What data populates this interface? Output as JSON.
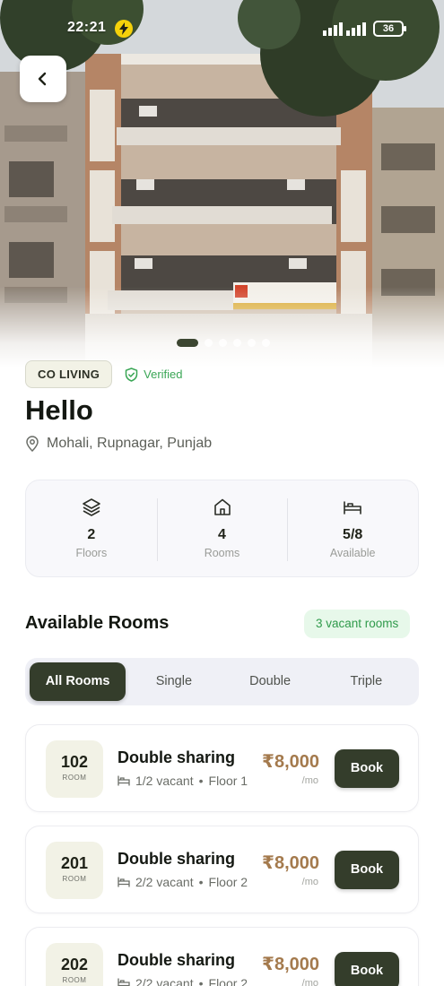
{
  "status_bar": {
    "time": "22:21",
    "battery": "36"
  },
  "gallery": {
    "image_count": 6,
    "active_index": 0
  },
  "property": {
    "category": "CO LIVING",
    "verified_label": "Verified",
    "name": "Hello",
    "location": "Mohali, Rupnagar, Punjab"
  },
  "stats": [
    {
      "icon": "layers-icon",
      "value": "2",
      "label": "Floors"
    },
    {
      "icon": "home-icon",
      "value": "4",
      "label": "Rooms"
    },
    {
      "icon": "bed-icon",
      "value": "5/8",
      "label": "Available"
    }
  ],
  "available_rooms": {
    "title": "Available Rooms",
    "vacant_badge": "3 vacant rooms",
    "tabs": [
      "All Rooms",
      "Single",
      "Double",
      "Triple"
    ],
    "active_tab": "All Rooms"
  },
  "rooms": [
    {
      "number": "102",
      "room_label": "ROOM",
      "type": "Double sharing",
      "vacancy": "1/2 vacant",
      "floor": "Floor 1",
      "price": "₹8,000",
      "period": "/mo",
      "book_label": "Book"
    },
    {
      "number": "201",
      "room_label": "ROOM",
      "type": "Double sharing",
      "vacancy": "2/2 vacant",
      "floor": "Floor 2",
      "price": "₹8,000",
      "period": "/mo",
      "book_label": "Book"
    },
    {
      "number": "202",
      "room_label": "ROOM",
      "type": "Double sharing",
      "vacancy": "2/2 vacant",
      "floor": "Floor 2",
      "price": "₹8,000",
      "period": "/mo",
      "book_label": "Book"
    }
  ],
  "colors": {
    "primary": "#343d2b",
    "accent_price": "#a47a4d",
    "success": "#3aa655"
  }
}
